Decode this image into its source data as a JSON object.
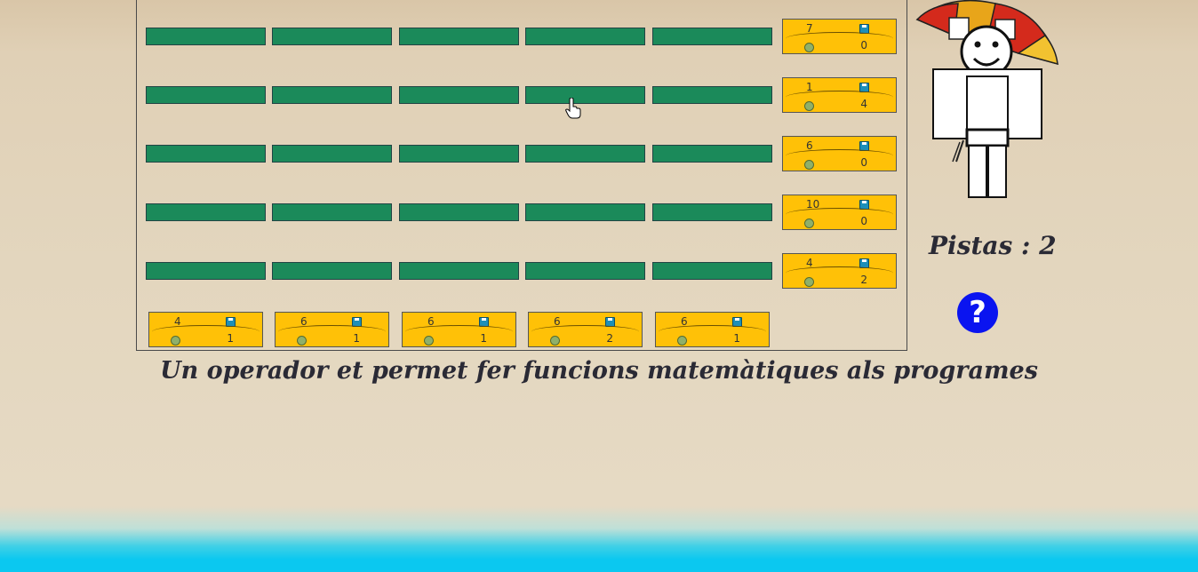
{
  "grid": {
    "rows": 5,
    "cols": 5
  },
  "row_cards": [
    {
      "top": "7",
      "bottom": "0"
    },
    {
      "top": "1",
      "bottom": "4"
    },
    {
      "top": "6",
      "bottom": "0"
    },
    {
      "top": "10",
      "bottom": "0"
    },
    {
      "top": "4",
      "bottom": "2"
    }
  ],
  "col_cards": [
    {
      "top": "4",
      "bottom": "1"
    },
    {
      "top": "6",
      "bottom": "1"
    },
    {
      "top": "6",
      "bottom": "1"
    },
    {
      "top": "6",
      "bottom": "2"
    },
    {
      "top": "6",
      "bottom": "1"
    }
  ],
  "hints_label": "Pistas : 2",
  "help_label": "?",
  "caption": "Un operador et permet fer funcions matemàtiques als programes",
  "colors": {
    "cell": "#1b8a5a",
    "card": "#ffc107",
    "help": "#0a14f0",
    "water": "#0bc8f0"
  }
}
